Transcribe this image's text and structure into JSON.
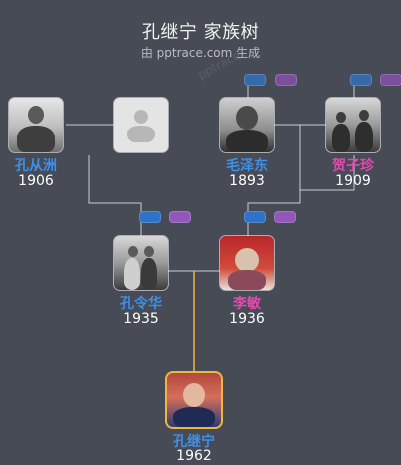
{
  "title": "孔继宁 家族树",
  "subtitle": "由 pptrace.com 生成",
  "watermark": "pptrace",
  "colors": {
    "background": "#474b55",
    "male_name": "#3f8fe8",
    "female_name": "#e14bb0",
    "line": "#c9ccd3",
    "self_line": "#f0b640",
    "father_pill": "#2f73c9",
    "mother_pill": "#9158b9"
  },
  "people": {
    "kong_congzhou": {
      "name": "孔从洲",
      "year": "1906",
      "gender": "male",
      "photo": "photo-soldier"
    },
    "unknown_spouse": {
      "name": "",
      "year": "",
      "gender": "female",
      "photo": "person-placeholder-icon"
    },
    "mao_zedong": {
      "name": "毛泽东",
      "year": "1893",
      "gender": "male",
      "photo": "photo-portrait"
    },
    "he_zizhen": {
      "name": "贺子珍",
      "year": "1909",
      "gender": "female",
      "photo": "photo-group"
    },
    "kong_linghua": {
      "name": "孔令华",
      "year": "1935",
      "gender": "male",
      "photo": "photo-couple"
    },
    "li_min": {
      "name": "李敏",
      "year": "1936",
      "gender": "female",
      "photo": "photo-elderly-woman"
    },
    "kong_jining": {
      "name": "孔继宁",
      "year": "1962",
      "gender": "male",
      "photo": "photo-man-suit"
    }
  }
}
